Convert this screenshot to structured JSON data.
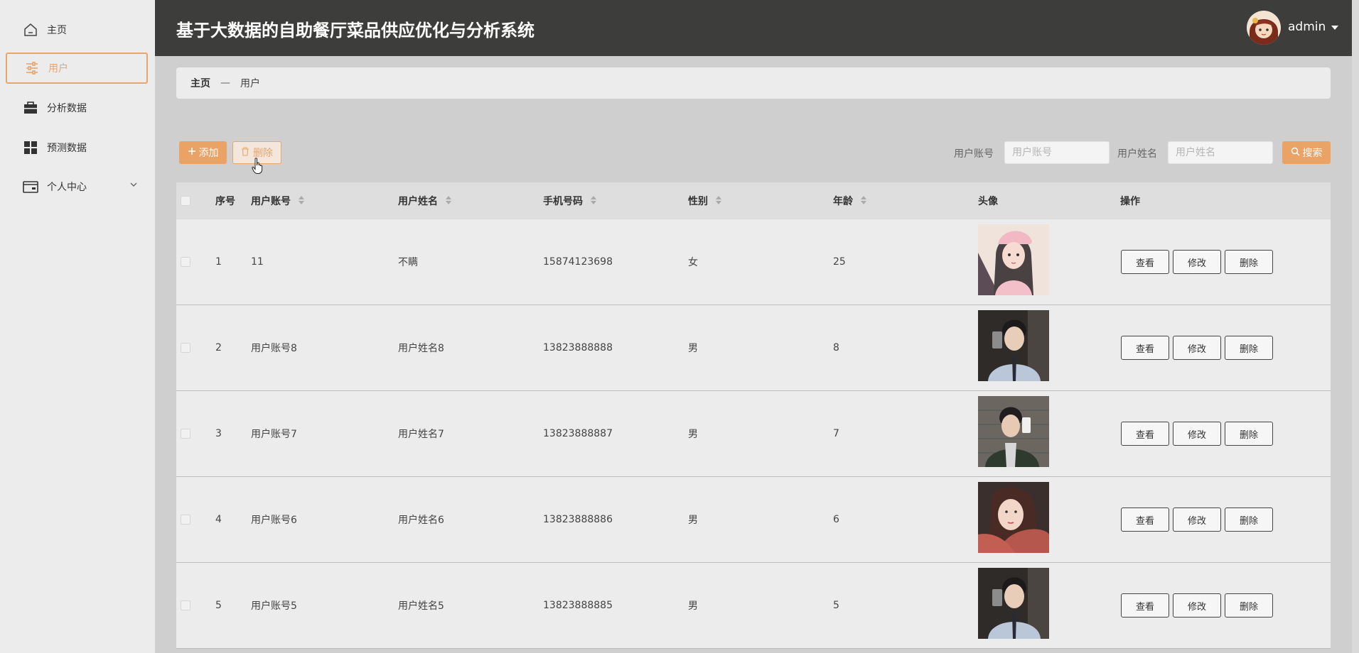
{
  "sidebar": {
    "items": [
      {
        "label": "主页",
        "icon": "home-icon"
      },
      {
        "label": "用户",
        "icon": "sliders-icon"
      },
      {
        "label": "分析数据",
        "icon": "briefcase-icon"
      },
      {
        "label": "预测数据",
        "icon": "grid-icon"
      },
      {
        "label": "个人中心",
        "icon": "wallet-icon"
      }
    ],
    "active_index": 1
  },
  "header": {
    "title": "基于大数据的自助餐厅菜品供应优化与分析系统",
    "user": "admin"
  },
  "breadcrumb": {
    "home": "主页",
    "separator": "—",
    "current": "用户"
  },
  "toolbar": {
    "add_label": "添加",
    "delete_label": "删除",
    "account_label": "用户账号",
    "account_placeholder": "用户账号",
    "name_label": "用户姓名",
    "name_placeholder": "用户姓名",
    "search_label": "搜索"
  },
  "table": {
    "headers": {
      "index": "序号",
      "account": "用户账号",
      "name": "用户姓名",
      "phone": "手机号码",
      "gender": "性别",
      "age": "年龄",
      "avatar": "头像",
      "actions": "操作"
    },
    "action_labels": {
      "view": "查看",
      "edit": "修改",
      "delete": "删除"
    },
    "rows": [
      {
        "index": "1",
        "account": "11",
        "name": "不瞒",
        "phone": "15874123698",
        "gender": "女",
        "age": "25"
      },
      {
        "index": "2",
        "account": "用户账号8",
        "name": "用户姓名8",
        "phone": "13823888888",
        "gender": "男",
        "age": "8"
      },
      {
        "index": "3",
        "account": "用户账号7",
        "name": "用户姓名7",
        "phone": "13823888887",
        "gender": "男",
        "age": "7"
      },
      {
        "index": "4",
        "account": "用户账号6",
        "name": "用户姓名6",
        "phone": "13823888886",
        "gender": "男",
        "age": "6"
      },
      {
        "index": "5",
        "account": "用户账号5",
        "name": "用户姓名5",
        "phone": "13823888885",
        "gender": "男",
        "age": "5"
      }
    ]
  },
  "colors": {
    "accent": "#eba265",
    "header_bg": "#3d3d3b",
    "sidebar_bg": "#ececec",
    "content_bg": "#cfcfcf"
  }
}
